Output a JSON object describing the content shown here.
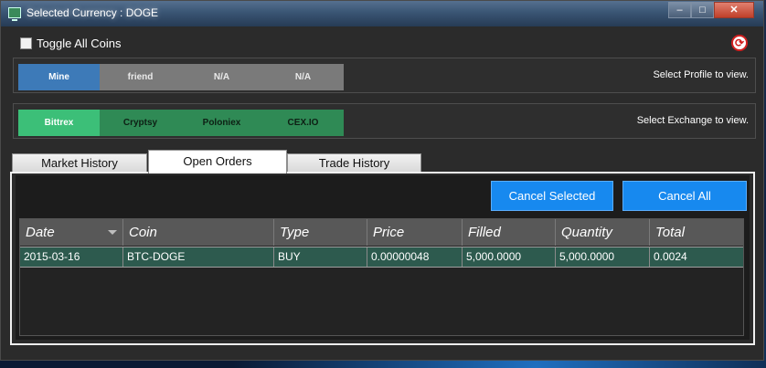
{
  "window": {
    "title": "Selected Currency : DOGE",
    "controls": {
      "minimize": "–",
      "maximize": "□",
      "close": "✕"
    }
  },
  "toggle": {
    "label": "Toggle All Coins",
    "checked": false
  },
  "refresh_icon": "refresh-icon",
  "profiles": {
    "items": [
      "Mine",
      "friend",
      "N/A",
      "N/A"
    ],
    "active_index": 0,
    "hint": "Select Profile to view."
  },
  "exchanges": {
    "items": [
      "Bittrex",
      "Cryptsy",
      "Poloniex",
      "CEX.IO"
    ],
    "active_index": 0,
    "hint": "Select Exchange to view."
  },
  "tabs": {
    "items": [
      "Market History",
      "Open Orders",
      "Trade History"
    ],
    "active_index": 1
  },
  "actions": {
    "cancel_selected": "Cancel Selected",
    "cancel_all": "Cancel All"
  },
  "grid": {
    "headers": [
      "Date",
      "Coin",
      "Type",
      "Price",
      "Filled",
      "Quantity",
      "Total"
    ],
    "rows": [
      [
        "2015-03-16",
        "BTC-DOGE",
        "BUY",
        "0.00000048",
        "5,000.0000",
        "5,000.0000",
        "0.0024"
      ]
    ]
  },
  "colors": {
    "profile_active": "#3d7ab8",
    "exchange_active": "#3cbf78",
    "action_button": "#1789ef",
    "selected_row": "#2d5a4e"
  }
}
